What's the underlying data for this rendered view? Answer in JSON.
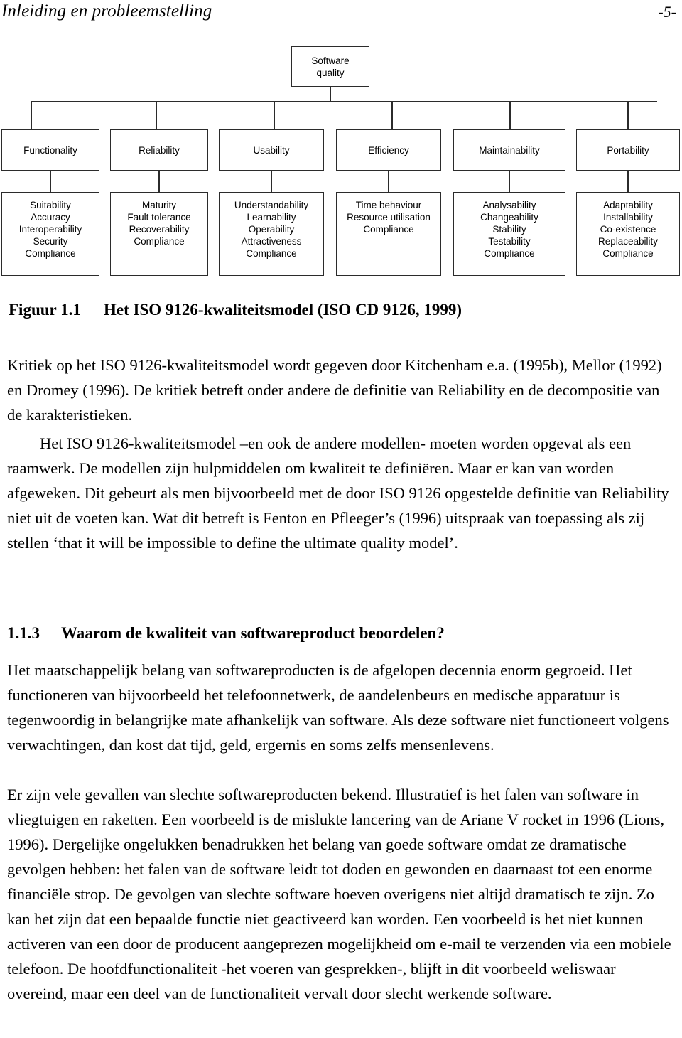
{
  "header": {
    "title": "Inleiding en probleemstelling",
    "page_number": "-5-"
  },
  "figure": {
    "root": "Software\nquality",
    "categories": [
      "Functionality",
      "Reliability",
      "Usability",
      "Efficiency",
      "Maintainability",
      "Portability"
    ],
    "subattributes": [
      "Suitability\nAccuracy\nInteroperability\nSecurity\nCompliance",
      "Maturity\nFault tolerance\nRecoverability\nCompliance",
      "Understandability\nLearnability\nOperability\nAttractiveness\nCompliance",
      "Time behaviour\nResource utilisation\nCompliance",
      "Analysability\nChangeability\nStability\nTestability\nCompliance",
      "Adaptability\nInstallability\nCo-existence\nReplaceability\nCompliance"
    ],
    "caption_label": "Figuur 1.1",
    "caption_text": "Het ISO 9126-kwaliteitsmodel (ISO CD 9126, 1999)"
  },
  "body": {
    "para1": "Kritiek op het ISO 9126-kwaliteitsmodel wordt gegeven door Kitchenham e.a. (1995b), Mellor (1992) en Dromey (1996). De kritiek betreft onder andere de definitie van Reliability en de decompositie van de karakteristieken.",
    "para2": "Het ISO 9126-kwaliteitsmodel –en ook de andere modellen- moeten worden opgevat als een raamwerk. De modellen zijn hulpmiddelen om kwaliteit te definiëren. Maar er kan van worden afgeweken. Dit gebeurt als men bijvoorbeeld met de door ISO 9126 opgestelde definitie van Reliability niet uit de voeten kan. Wat dit betreft is Fenton en Pfleeger’s (1996) uitspraak van toepassing als zij stellen ‘that it will be impossible to define the ultimate quality model’.",
    "heading_number": "1.1.3",
    "heading_text": "Waarom de kwaliteit van softwareproduct beoordelen?",
    "para3": "Het maatschappelijk belang van softwareproducten is de afgelopen decennia enorm gegroeid. Het functioneren van bijvoorbeeld het telefoonnetwerk, de aandelenbeurs en medische apparatuur is tegenwoordig in belangrijke mate afhankelijk van software. Als deze software niet functioneert volgens verwachtingen, dan kost dat tijd, geld, ergernis en soms zelfs mensenlevens.",
    "para4": "Er zijn vele gevallen van slechte softwareproducten bekend. Illustratief is het falen van software in vliegtuigen en raketten. Een voorbeeld is de mislukte lancering van de Ariane V rocket in 1996 (Lions, 1996). Dergelijke ongelukken benadrukken het belang van goede software omdat ze dramatische gevolgen hebben: het falen van de software leidt tot doden en gewonden en daarnaast tot een enorme financiële strop. De gevolgen van slechte software hoeven overigens niet altijd dramatisch te zijn. Zo kan het zijn dat een bepaalde functie niet geactiveerd kan worden. Een voorbeeld is het niet kunnen activeren van een door de producent aangeprezen mogelijkheid om e-mail te verzenden via een mobiele telefoon. De hoofdfunctionaliteit -het voeren van gesprekken-, blijft in dit voorbeeld weliswaar overeind, maar een deel van de functionaliteit vervalt door slecht werkende software."
  },
  "colors": {
    "text": "#000000",
    "box_border": "#2b2b2b",
    "page_background": "#ffffff"
  }
}
